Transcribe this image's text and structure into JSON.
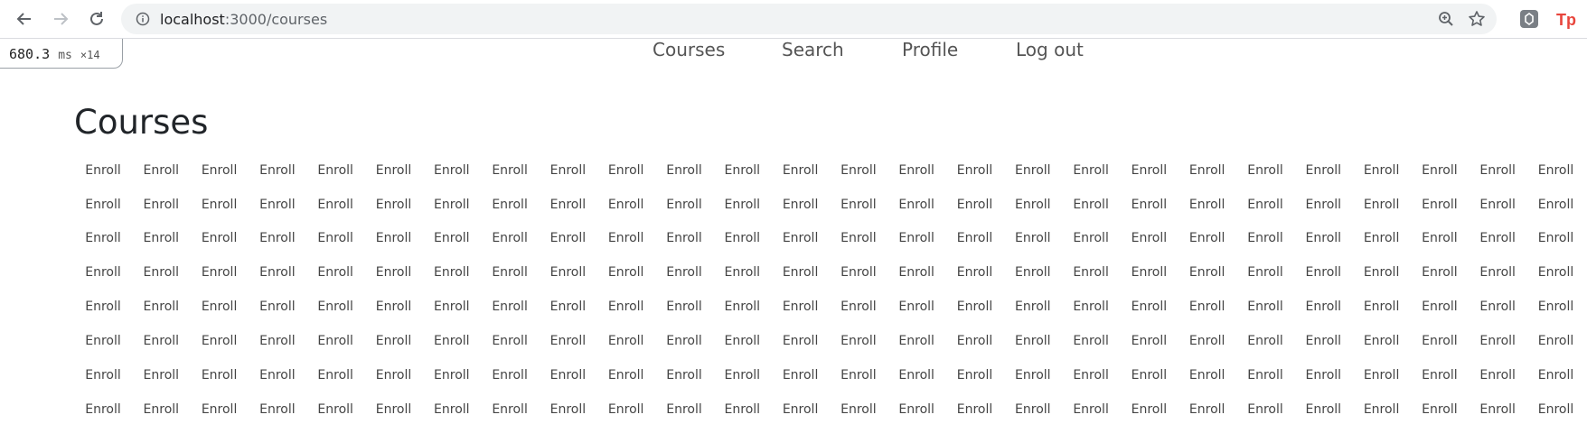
{
  "browser": {
    "url_host": "localhost",
    "url_path": ":3000/courses"
  },
  "profiler": {
    "time": "680.3",
    "unit": "ms",
    "count": "×14"
  },
  "nav": {
    "items": [
      "Courses",
      "Search",
      "Profile",
      "Log out"
    ]
  },
  "page": {
    "title": "Courses"
  },
  "enroll_label": "Enroll",
  "icons": {
    "back": "back-arrow-icon",
    "forward": "forward-arrow-icon",
    "reload": "reload-icon",
    "info": "info-icon",
    "zoom": "zoom-icon",
    "bookmark": "star-icon",
    "ext1": "extension-icon",
    "ext2": "tp-extension-icon"
  },
  "colors": {
    "ext2": "#e8453c"
  }
}
